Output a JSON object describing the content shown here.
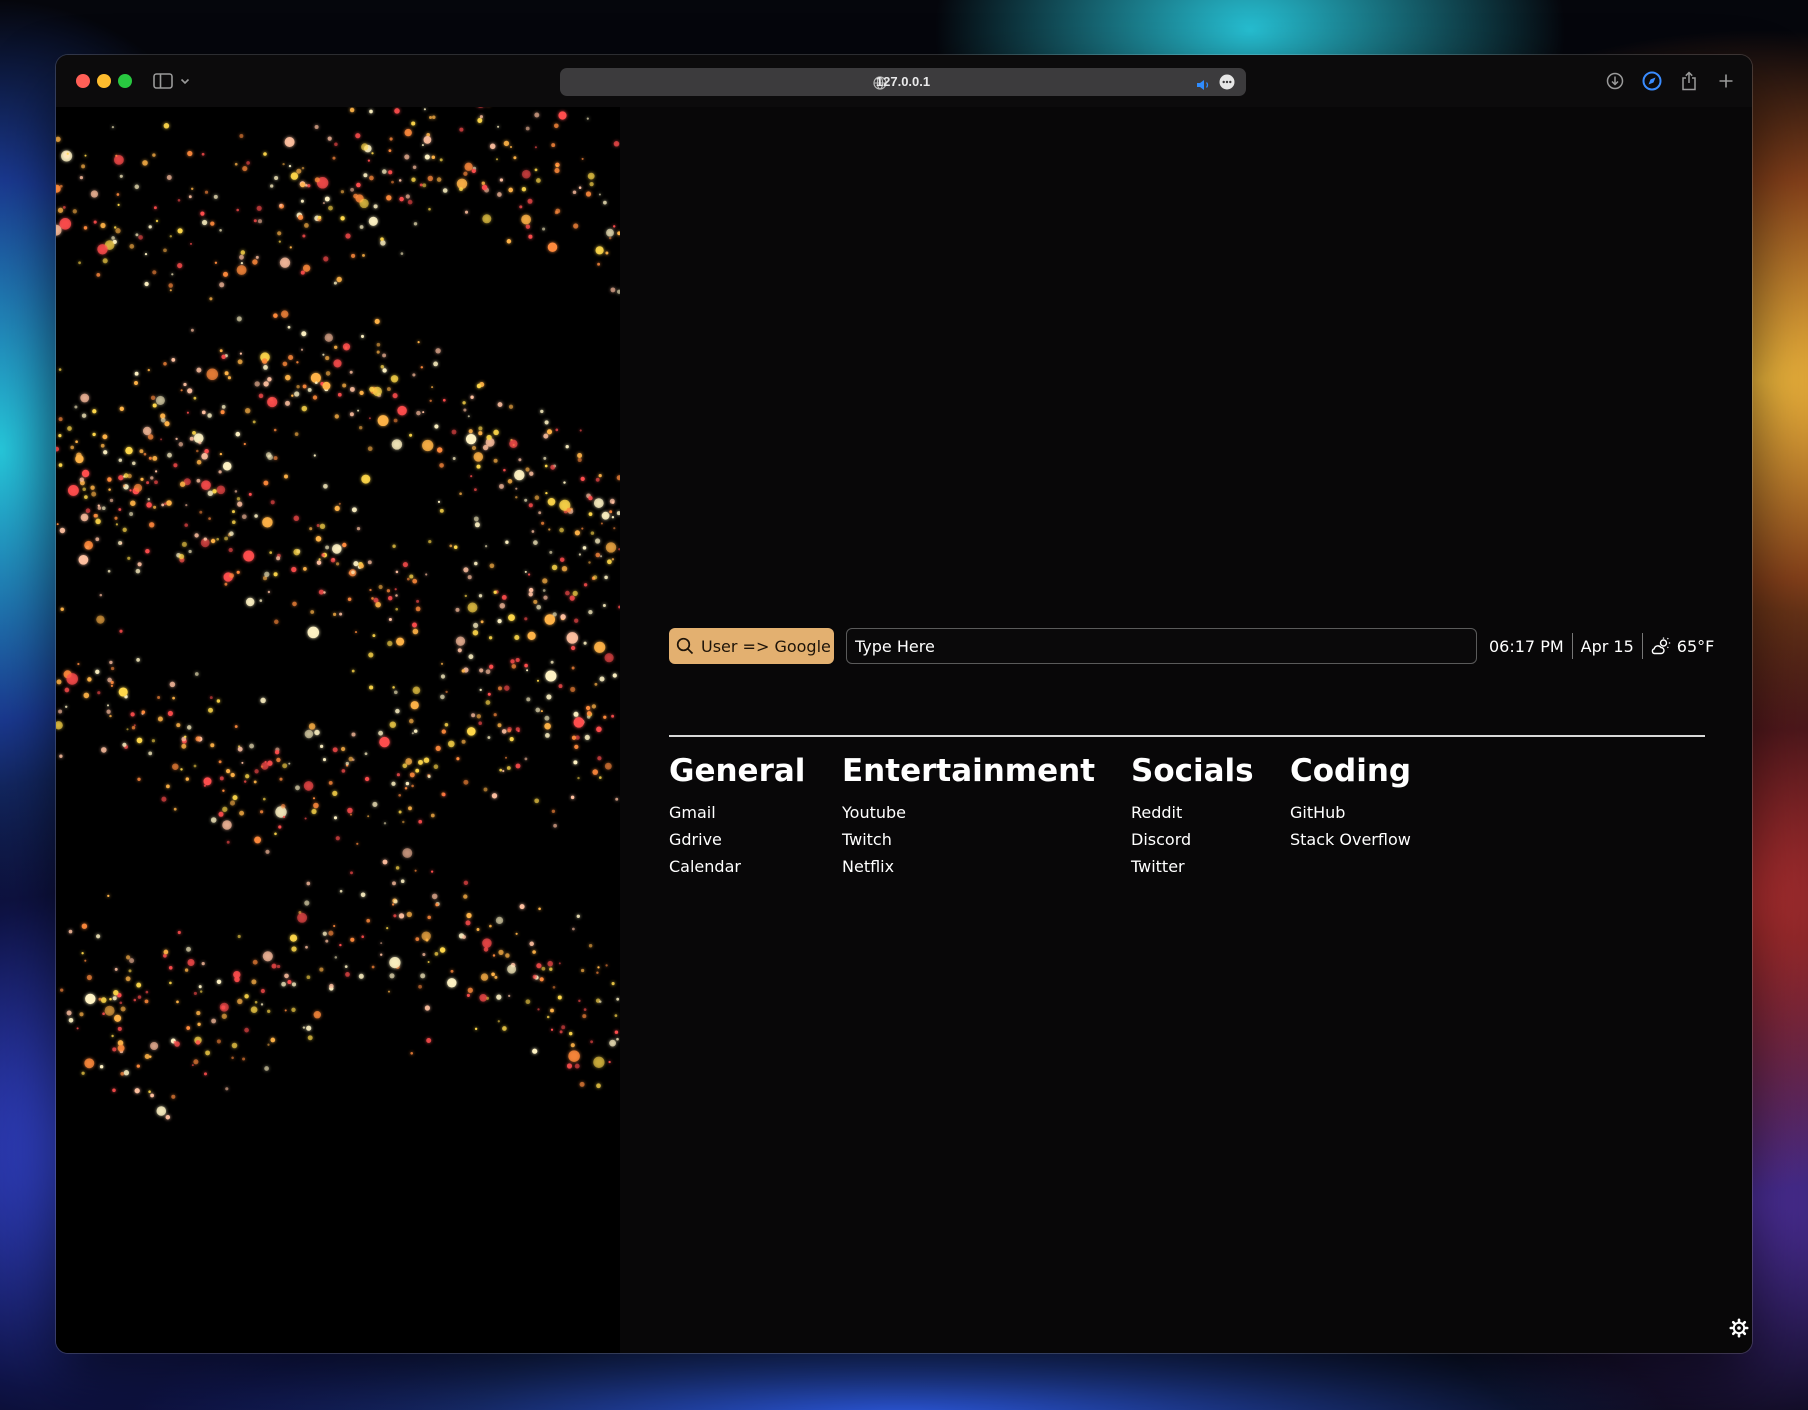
{
  "browser": {
    "address": "127.0.0.1",
    "icons": {
      "sidebar": "sidebar-icon",
      "chevron": "chevron-down-icon",
      "site": "globe-icon",
      "audio": "speaker-icon",
      "more": "ellipsis-icon",
      "download": "download-icon",
      "extension": "compass-icon",
      "share": "share-icon",
      "new_tab": "plus-icon"
    }
  },
  "search": {
    "engine_label": "User => Google",
    "placeholder": "Type Here",
    "engine_icon": "search-icon"
  },
  "status": {
    "time": "06:17 PM",
    "date": "Apr 15",
    "weather_icon": "partly-cloudy-icon",
    "temperature": "65°F"
  },
  "categories": [
    {
      "title": "General",
      "links": [
        "Gmail",
        "Gdrive",
        "Calendar"
      ]
    },
    {
      "title": "Entertainment",
      "links": [
        "Youtube",
        "Twitch",
        "Netflix"
      ]
    },
    {
      "title": "Socials",
      "links": [
        "Reddit",
        "Discord",
        "Twitter"
      ]
    },
    {
      "title": "Coding",
      "links": [
        "GitHub",
        "Stack Overflow"
      ]
    }
  ],
  "settings_icon": "gear-icon",
  "colors": {
    "accent": "#e3b070",
    "background": "#080708",
    "text": "#ffffff",
    "particle_palette": [
      "#ffd84a",
      "#ffb347",
      "#ff8a3c",
      "#ffc0a0",
      "#ff4d4d",
      "#fff3c4"
    ]
  }
}
